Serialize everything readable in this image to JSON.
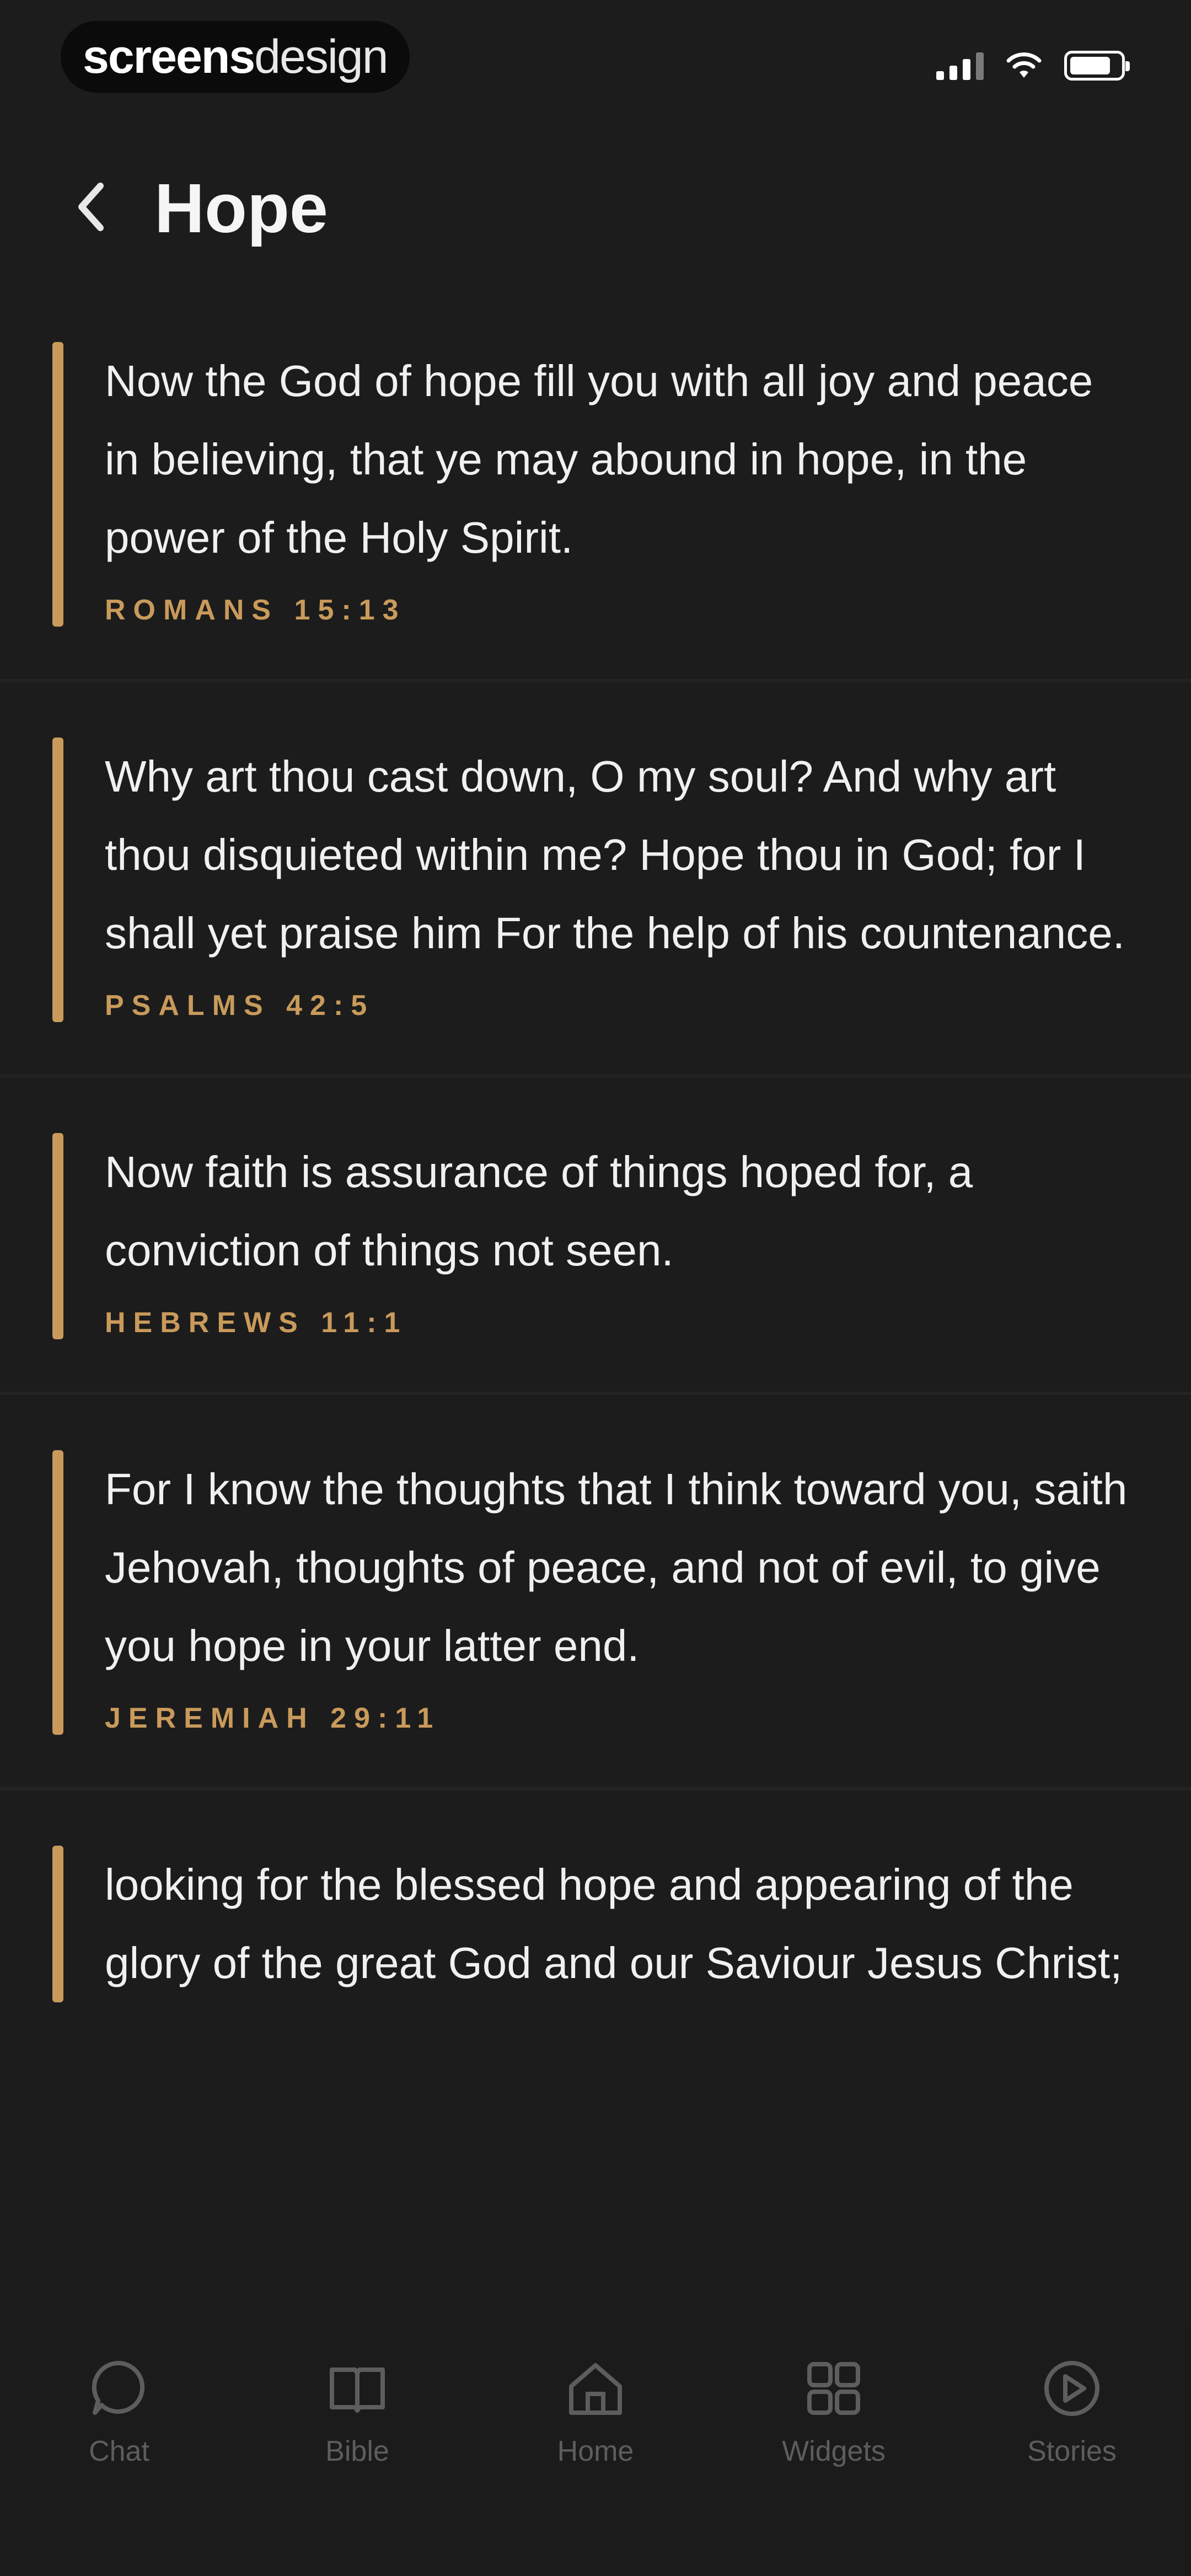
{
  "status": {
    "brand_bold": "screens",
    "brand_light": "design"
  },
  "header": {
    "title": "Hope"
  },
  "verses": [
    {
      "text": "Now the God of hope fill you with all joy and peace in believing, that ye may abound in hope, in the power of the Holy Spirit.",
      "ref": "ROMANS 15:13"
    },
    {
      "text": "Why art thou cast down, O my soul? And why art thou disquieted within me? Hope thou in God; for I shall yet praise him For the help of his countenance.",
      "ref": "PSALMS 42:5"
    },
    {
      "text": "Now faith is assurance of things hoped for, a conviction of things not seen.",
      "ref": "HEBREWS 11:1"
    },
    {
      "text": "For I know the thoughts that I think toward you, saith Jehovah, thoughts of peace, and not of evil, to give you hope in your latter end.",
      "ref": "JEREMIAH 29:11"
    },
    {
      "text": "looking for the blessed hope and appearing of the glory of the great God and our Saviour Jesus Christ;",
      "ref": ""
    }
  ],
  "tabs": [
    {
      "label": "Chat",
      "icon": "chat-icon"
    },
    {
      "label": "Bible",
      "icon": "book-icon"
    },
    {
      "label": "Home",
      "icon": "home-icon"
    },
    {
      "label": "Widgets",
      "icon": "widgets-icon"
    },
    {
      "label": "Stories",
      "icon": "play-icon"
    }
  ],
  "colors": {
    "accent": "#c99a5b",
    "background": "#1c1c1c",
    "tab_inactive": "#5d5d5d"
  }
}
